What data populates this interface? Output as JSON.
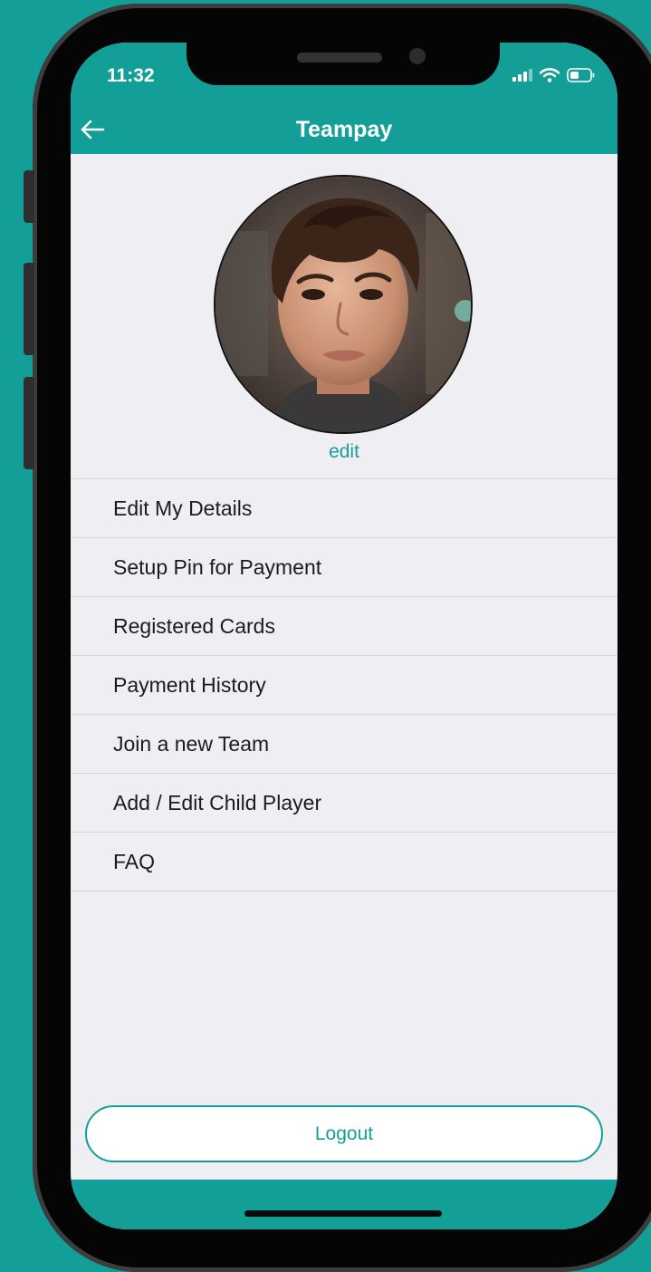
{
  "status_bar": {
    "time": "11:32"
  },
  "header": {
    "title": "Teampay",
    "back_icon": "arrow-left-icon"
  },
  "profile": {
    "edit_label": "edit"
  },
  "menu": {
    "items": [
      {
        "label": "Edit My Details"
      },
      {
        "label": "Setup Pin for Payment"
      },
      {
        "label": "Registered Cards"
      },
      {
        "label": "Payment History"
      },
      {
        "label": "Join a new Team"
      },
      {
        "label": "Add / Edit Child Player"
      },
      {
        "label": "FAQ"
      }
    ]
  },
  "logout_label": "Logout",
  "colors": {
    "brand": "#139e97",
    "background": "#efeef3",
    "text": "#1c1c1e"
  }
}
